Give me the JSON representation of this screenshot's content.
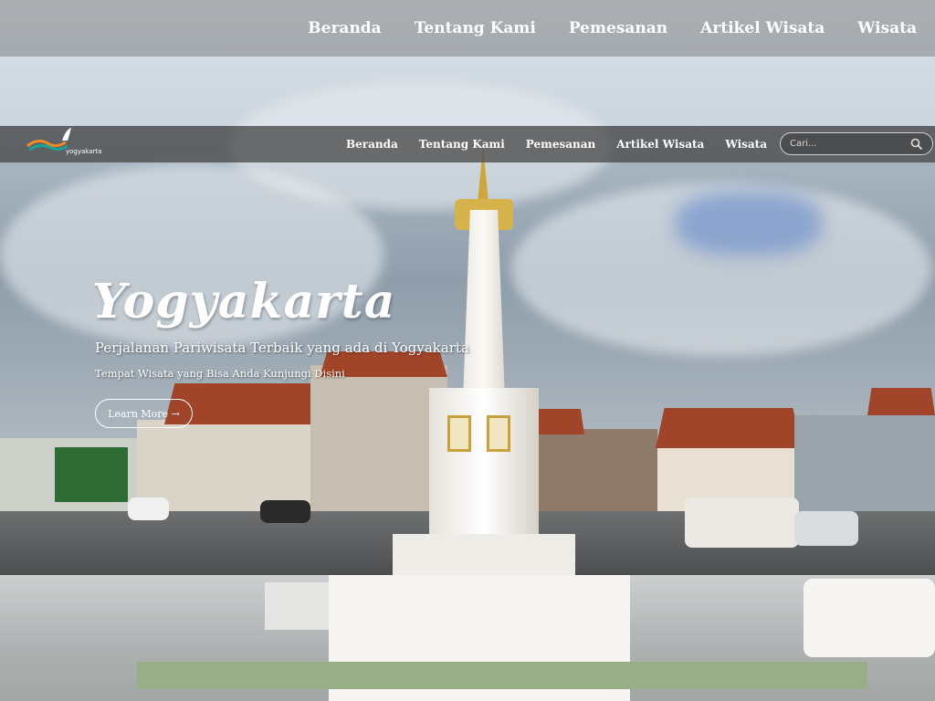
{
  "top_nav": {
    "items": [
      "Beranda",
      "Tentang Kami",
      "Pemesanan",
      "Artikel Wisata",
      "Wisata"
    ]
  },
  "navbar": {
    "logo_text": "yogyakarta",
    "items": [
      "Beranda",
      "Tentang Kami",
      "Pemesanan",
      "Artikel Wisata",
      "Wisata"
    ],
    "search_placeholder": "Cari..."
  },
  "hero": {
    "title": "Yogyakarta",
    "subtitle": "Perjalanan Pariwisata Terbaik yang ada di Yogyakarta",
    "tagline": "Tempat Wisata yang Bisa Anda Kunjungi Disini",
    "button_label": "Learn More →"
  },
  "icons": {
    "search": "search-icon",
    "logo": "bird-wave-logo"
  },
  "colors": {
    "navbar_bg": "#464646",
    "text": "#ffffff",
    "logo_orange": "#f08a24",
    "logo_teal": "#1aa39a"
  }
}
